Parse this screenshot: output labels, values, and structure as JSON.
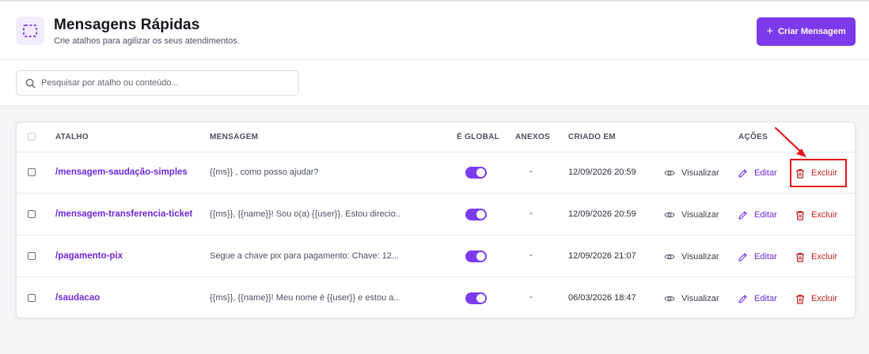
{
  "header": {
    "title": "Mensagens Rápidas",
    "subtitle": "Crie atalhos para agilizar os seus atendimentos.",
    "create_button": "Criar Mensagem",
    "create_plus": "+"
  },
  "search": {
    "placeholder": "Pesquisar por atalho ou conteúdo..."
  },
  "table": {
    "columns": {
      "shortcut": "ATALHO",
      "message": "MENSAGEM",
      "global": "É GLOBAL",
      "attachments": "ANEXOS",
      "created": "CRIADO EM",
      "actions": "AÇÕES"
    },
    "action_labels": {
      "view": "Visualizar",
      "edit": "Editar",
      "delete": "Excluir"
    },
    "rows": [
      {
        "shortcut": "/mensagem-saudação-simples",
        "message": "{{ms}} , como posso ajudar?",
        "global": true,
        "attachments": "-",
        "created": "12/09/2026 20:59"
      },
      {
        "shortcut": "/mensagem-transferencia-ticket",
        "message": "{{ms}}, {{name}}! Sou o(a) {{user}}. Estou direcio...",
        "global": true,
        "attachments": "-",
        "created": "12/09/2026 20:59"
      },
      {
        "shortcut": "/pagamento-pix",
        "message": "Segue a chave pix para pagamento: Chave: 12...",
        "global": true,
        "attachments": "-",
        "created": "12/09/2026 21:07"
      },
      {
        "shortcut": "/saudacao",
        "message": "{{ms}}, {{name}}! Meu nome é {{user}} e estou a...",
        "global": true,
        "attachments": "-",
        "created": "06/03/2026 18:47"
      }
    ]
  },
  "colors": {
    "accent": "#7c3aed",
    "shortcut_text": "#6d28d9",
    "delete": "#c81e1e",
    "annotation": "#e4141b"
  },
  "icons": {
    "logo": "dashed-square-icon",
    "search": "search-icon",
    "view": "eye-icon",
    "edit": "pencil-icon",
    "delete": "trash-icon"
  }
}
